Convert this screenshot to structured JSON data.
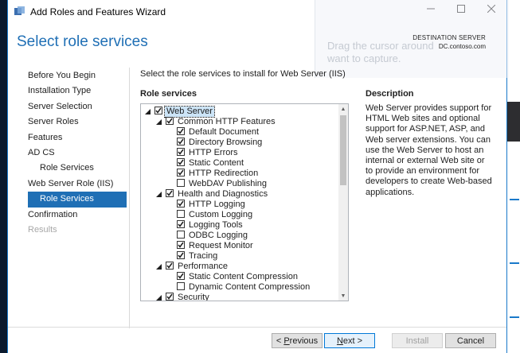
{
  "window": {
    "title": "Add Roles and Features Wizard"
  },
  "ghost_tip": {
    "line1": "Drag the cursor around",
    "line2": "want to capture."
  },
  "header": {
    "title": "Select role services",
    "dest_label": "DESTINATION SERVER",
    "dest_server": "DC.contoso.com"
  },
  "nav": {
    "items": [
      {
        "label": "Before You Begin"
      },
      {
        "label": "Installation Type"
      },
      {
        "label": "Server Selection"
      },
      {
        "label": "Server Roles"
      },
      {
        "label": "Features"
      },
      {
        "label": "AD CS"
      },
      {
        "label": "Role Services"
      },
      {
        "label": "Web Server Role (IIS)"
      },
      {
        "label": "Role Services"
      },
      {
        "label": "Confirmation"
      },
      {
        "label": "Results"
      }
    ]
  },
  "main": {
    "instruction": "Select the role services to install for Web Server (IIS)",
    "tree_header": "Role services",
    "description_header": "Description",
    "description": "Web Server provides support for HTML Web sites and optional support for ASP.NET, ASP, and Web server extensions. You can use the Web Server to host an internal or external Web site or to provide an environment for developers to create Web-based applications."
  },
  "tree": [
    {
      "label": "Web Server",
      "checked": true,
      "level": 0,
      "expanded": true,
      "selected": true
    },
    {
      "label": "Common HTTP Features",
      "checked": true,
      "level": 1,
      "expanded": true
    },
    {
      "label": "Default Document",
      "checked": true,
      "level": 2
    },
    {
      "label": "Directory Browsing",
      "checked": true,
      "level": 2
    },
    {
      "label": "HTTP Errors",
      "checked": true,
      "level": 2
    },
    {
      "label": "Static Content",
      "checked": true,
      "level": 2
    },
    {
      "label": "HTTP Redirection",
      "checked": true,
      "level": 2
    },
    {
      "label": "WebDAV Publishing",
      "checked": false,
      "level": 2
    },
    {
      "label": "Health and Diagnostics",
      "checked": true,
      "level": 1,
      "expanded": true
    },
    {
      "label": "HTTP Logging",
      "checked": true,
      "level": 2
    },
    {
      "label": "Custom Logging",
      "checked": false,
      "level": 2
    },
    {
      "label": "Logging Tools",
      "checked": true,
      "level": 2
    },
    {
      "label": "ODBC Logging",
      "checked": false,
      "level": 2
    },
    {
      "label": "Request Monitor",
      "checked": true,
      "level": 2
    },
    {
      "label": "Tracing",
      "checked": true,
      "level": 2
    },
    {
      "label": "Performance",
      "checked": true,
      "level": 1,
      "expanded": true
    },
    {
      "label": "Static Content Compression",
      "checked": true,
      "level": 2
    },
    {
      "label": "Dynamic Content Compression",
      "checked": false,
      "level": 2
    },
    {
      "label": "Security",
      "checked": true,
      "level": 1,
      "expanded": true
    }
  ],
  "buttons": {
    "previous_prefix": "< ",
    "previous_hotkey": "P",
    "previous_rest": "revious",
    "next_hotkey": "N",
    "next_rest": "ext >",
    "install": "Install",
    "cancel": "Cancel"
  },
  "colors": {
    "accent": "#1f6fb5",
    "selection": "#cce4f7"
  }
}
